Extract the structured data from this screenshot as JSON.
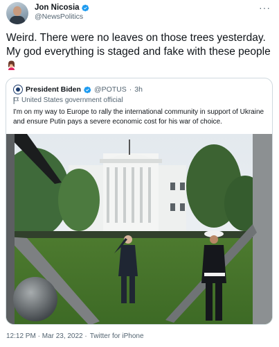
{
  "tweet": {
    "author": {
      "display_name": "Jon Nicosia",
      "handle": "@NewsPolitics",
      "verified": true
    },
    "more_icon": "more-dots-icon",
    "text": "Weird.  There were no leaves on those trees yesterday.  My god everything is staged and fake with these people",
    "emoji": "woman-facepalming-emoji",
    "quoted": {
      "display_name": "President Biden",
      "handle": "@POTUS",
      "separator": "·",
      "time": "3h",
      "verified": true,
      "label": "United States government official",
      "text": "I'm on my way to Europe to rally the international community in support of Ukraine and ensure Putin pays a severe economic cost for his war of choice."
    },
    "footer": {
      "timestamp": "12:12 PM · Mar 23, 2022 ·",
      "source": "Twitter for iPhone"
    }
  },
  "colors": {
    "text": "#0f1419",
    "secondary": "#536471",
    "verified": "#1d9bf0",
    "border": "#cfd9de"
  }
}
